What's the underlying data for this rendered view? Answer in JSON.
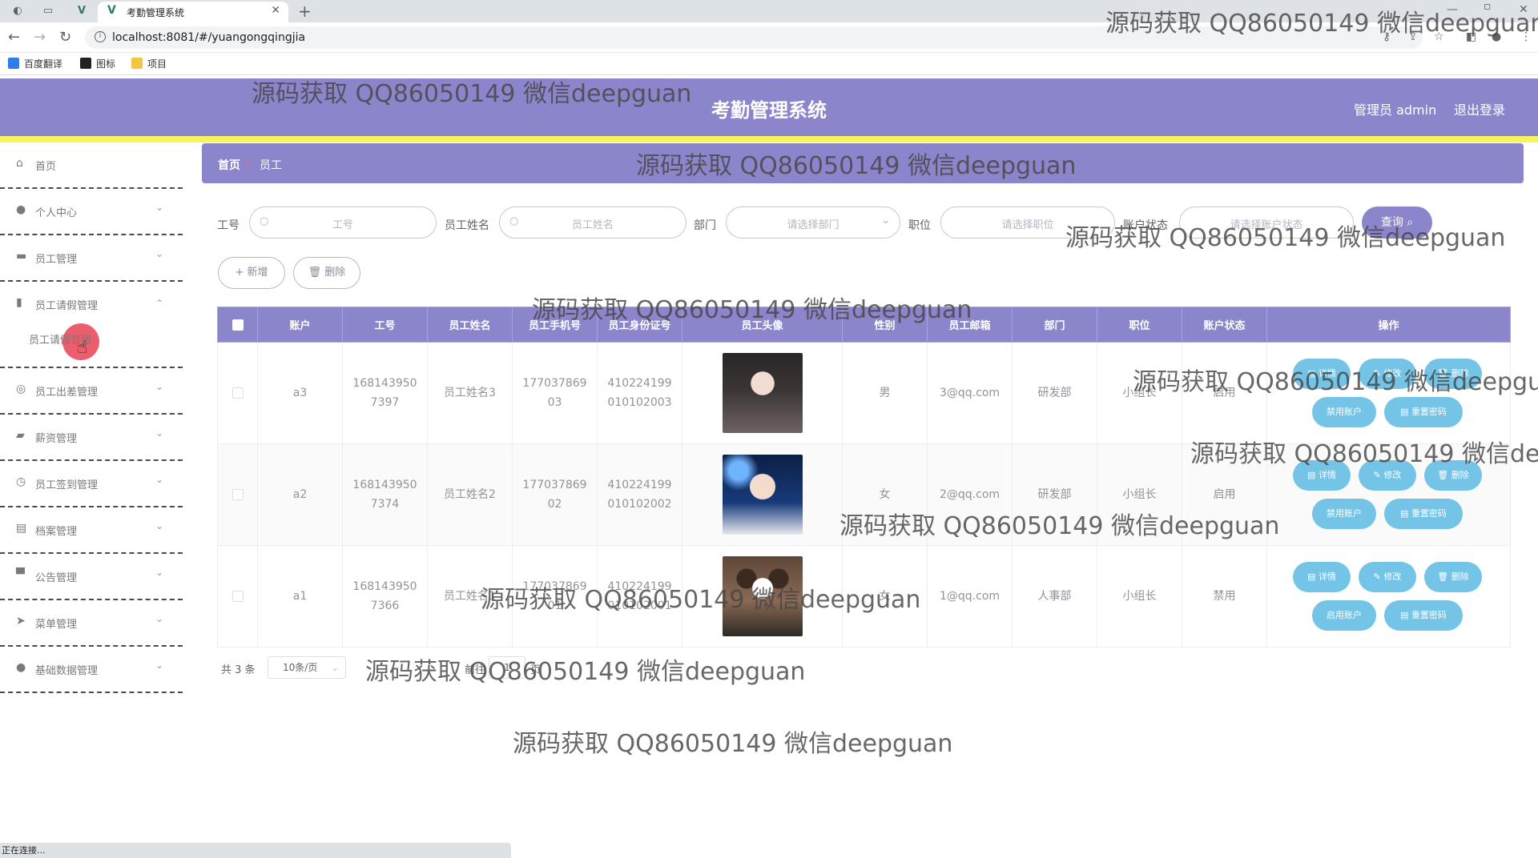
{
  "browser": {
    "tab_title": "考勤管理系统",
    "url": "localhost:8081/#/yuangongqingjia",
    "bookmarks": [
      "百度翻译",
      "图标",
      "项目"
    ],
    "status_text": "正在连接..."
  },
  "header": {
    "title": "考勤管理系统",
    "user": "管理员 admin",
    "logout": "退出登录"
  },
  "sidebar": {
    "items": [
      {
        "label": "首页",
        "icon": "home-icon"
      },
      {
        "label": "个人中心",
        "icon": "user-icon"
      },
      {
        "label": "员工管理",
        "icon": "folder-icon"
      },
      {
        "label": "员工请假管理",
        "icon": "bar-chart-icon"
      },
      {
        "label": "员工出差管理",
        "icon": "target-icon"
      },
      {
        "label": "薪资管理",
        "icon": "briefcase-icon"
      },
      {
        "label": "员工签到管理",
        "icon": "clock-icon"
      },
      {
        "label": "档案管理",
        "icon": "clipboard-icon"
      },
      {
        "label": "公告管理",
        "icon": "monitor-icon"
      },
      {
        "label": "菜单管理",
        "icon": "send-icon"
      },
      {
        "label": "基础数据管理",
        "icon": "user-icon"
      }
    ],
    "sub_item": "员工请假管理"
  },
  "breadcrumb": {
    "home": "首页",
    "sep": "/",
    "current": "员工"
  },
  "search": {
    "f1_label": "工号",
    "f1_placeholder": "工号",
    "f2_label": "员工姓名",
    "f2_placeholder": "员工姓名",
    "f3_label": "部门",
    "f3_placeholder": "请选择部门",
    "f4_label": "职位",
    "f4_placeholder": "请选择职位",
    "f5_label": "账户状态",
    "f5_placeholder": "请选择账户状态",
    "button": "查询"
  },
  "actions": {
    "add": "+ 新增",
    "delete": "🗑 删除"
  },
  "table": {
    "headers": [
      "账户",
      "工号",
      "员工姓名",
      "员工手机号",
      "员工身份证号",
      "员工头像",
      "性别",
      "员工邮箱",
      "部门",
      "职位",
      "账户状态",
      "操作"
    ],
    "rows": [
      {
        "account": "a3",
        "job_no": "1681439507397",
        "name": "员工姓名3",
        "phone": "17703786903",
        "id_card": "410224199010102003",
        "gender": "男",
        "email": "3@qq.com",
        "dept": "研发部",
        "position": "小组长",
        "status": "启用",
        "toggle_btn": "禁用账户"
      },
      {
        "account": "a2",
        "job_no": "1681439507374",
        "name": "员工姓名2",
        "phone": "17703786902",
        "id_card": "410224199010102002",
        "gender": "女",
        "email": "2@qq.com",
        "dept": "研发部",
        "position": "小组长",
        "status": "启用",
        "toggle_btn": "禁用账户"
      },
      {
        "account": "a1",
        "job_no": "1681439507366",
        "name": "员工姓名1",
        "phone": "17703786901",
        "id_card": "410224199010102001",
        "gender": "女",
        "email": "1@qq.com",
        "dept": "人事部",
        "position": "小组长",
        "status": "禁用",
        "toggle_btn": "启用账户"
      }
    ],
    "op_detail": "详情",
    "op_edit": "修改",
    "op_delete": "删除",
    "op_reset": "重置密码"
  },
  "pagination": {
    "total": "共 3 条",
    "page_size": "10条/页",
    "jump_label": "前往",
    "jump_value": "1",
    "jump_suffix": "页"
  },
  "watermark": "源码获取 QQ86050149 微信deepguan",
  "colors": {
    "primary": "#8b86cc",
    "accent_line": "#f7f35b",
    "op_button": "#74c4e8"
  }
}
